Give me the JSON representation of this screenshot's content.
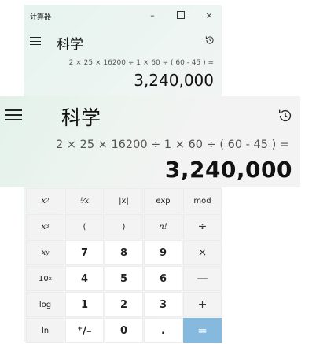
{
  "window": {
    "title": "计算器",
    "controls": {
      "minimize": "–",
      "close": "×"
    }
  },
  "header": {
    "mode": "科学"
  },
  "display": {
    "expression": "2 × 25 × 16200 ÷ 1 × 60 ÷ ( 60 - 45 ) =",
    "result": "3,240,000"
  },
  "keypad": {
    "rows": [
      [
        {
          "label": "x²",
          "base": "x",
          "sup": "2",
          "kind": "fn",
          "italic": true,
          "name": "square-button"
        },
        {
          "label": "¹⁄x",
          "kind": "fn",
          "italic": true,
          "name": "reciprocal-button"
        },
        {
          "label": "|x|",
          "kind": "fn",
          "name": "absolute-button"
        },
        {
          "label": "exp",
          "kind": "fn",
          "name": "exp-button"
        },
        {
          "label": "mod",
          "kind": "fn",
          "name": "mod-button"
        }
      ],
      [
        {
          "label": "x³",
          "base": "x",
          "sup": "3",
          "kind": "fn",
          "italic": true,
          "name": "cube-button"
        },
        {
          "label": "(",
          "kind": "fn",
          "name": "open-paren-button"
        },
        {
          "label": ")",
          "kind": "fn",
          "name": "close-paren-button"
        },
        {
          "label": "n!",
          "kind": "fn",
          "italic": true,
          "name": "factorial-button"
        },
        {
          "label": "÷",
          "kind": "op",
          "name": "divide-button"
        }
      ],
      [
        {
          "label": "xʸ",
          "base": "x",
          "sup": "y",
          "kind": "fn",
          "italic": true,
          "name": "power-button"
        },
        {
          "label": "7",
          "kind": "num",
          "name": "digit-7-button"
        },
        {
          "label": "8",
          "kind": "num",
          "name": "digit-8-button"
        },
        {
          "label": "9",
          "kind": "num",
          "name": "digit-9-button"
        },
        {
          "label": "×",
          "kind": "op",
          "name": "multiply-button"
        }
      ],
      [
        {
          "label": "10ˣ",
          "base": "10",
          "sup": "x",
          "kind": "fn",
          "name": "ten-power-button"
        },
        {
          "label": "4",
          "kind": "num",
          "name": "digit-4-button"
        },
        {
          "label": "5",
          "kind": "num",
          "name": "digit-5-button"
        },
        {
          "label": "6",
          "kind": "num",
          "name": "digit-6-button"
        },
        {
          "label": "—",
          "kind": "op",
          "name": "subtract-button"
        }
      ],
      [
        {
          "label": "log",
          "kind": "fn",
          "name": "log-button"
        },
        {
          "label": "1",
          "kind": "num",
          "name": "digit-1-button"
        },
        {
          "label": "2",
          "kind": "num",
          "name": "digit-2-button"
        },
        {
          "label": "3",
          "kind": "num",
          "name": "digit-3-button"
        },
        {
          "label": "+",
          "kind": "op",
          "name": "add-button"
        }
      ],
      [
        {
          "label": "ln",
          "kind": "fn",
          "name": "ln-button"
        },
        {
          "label": "⁺∕₋",
          "kind": "num",
          "name": "negate-button"
        },
        {
          "label": "0",
          "kind": "num",
          "name": "digit-0-button"
        },
        {
          "label": ".",
          "kind": "num",
          "name": "decimal-button"
        },
        {
          "label": "=",
          "kind": "eq",
          "name": "equals-button"
        }
      ]
    ]
  },
  "colors": {
    "accent": "#86b9de",
    "background_tint": "#e6f3ee"
  },
  "icons": {
    "menu": "hamburger-icon",
    "history": "history-icon"
  }
}
